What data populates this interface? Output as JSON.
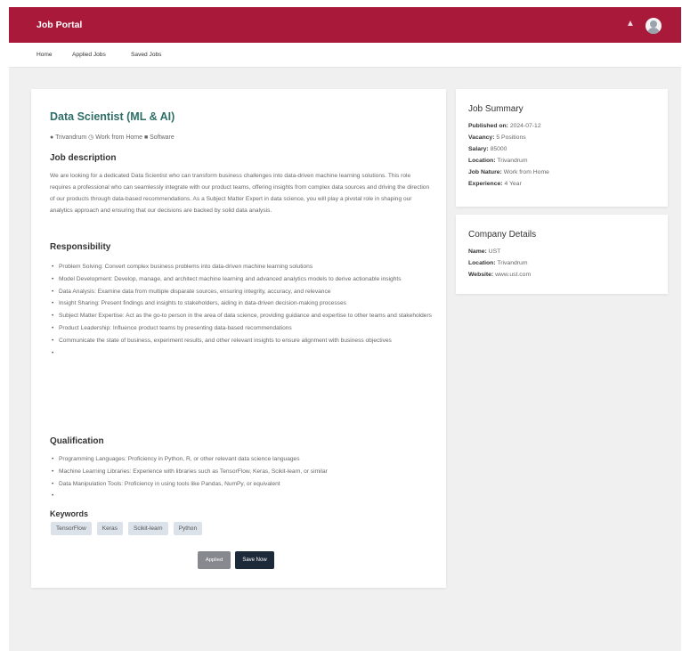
{
  "header": {
    "brand": "Job Portal"
  },
  "nav": {
    "items": [
      "Home",
      "Applied Jobs",
      "Saved Jobs"
    ]
  },
  "job": {
    "title": "Data Scientist (ML & AI)",
    "location": "Trivandrum",
    "work_mode": "Work from Home",
    "category": "Software",
    "description_heading": "Job description",
    "description": "We are looking for a dedicated Data Scientist who can transform business challenges into data-driven machine learning solutions. This role requires a professional who can seamlessly integrate with our product teams, offering insights from complex data sources and driving the direction of our products through data-based recommendations. As a Subject Matter Expert in data science, you will play a pivotal role in shaping our analytics approach and ensuring that our decisions are backed by solid data analysis.",
    "responsibility_heading": "Responsibility",
    "responsibilities": [
      "Problem Solving: Convert complex business problems into data-driven machine learning solutions",
      "Model Development: Develop, manage, and architect machine learning and advanced analytics models to derive actionable insights",
      "Data Analysis: Examine data from multiple disparate sources, ensuring integrity, accuracy, and relevance",
      "Insight Sharing: Present findings and insights to stakeholders, aiding in data-driven decision-making processes",
      "Subject Matter Expertise: Act as the go-to person in the area of data science, providing guidance and expertise to other teams and stakeholders",
      "Product Leadership: Influence product teams by presenting data-based recommendations",
      "Communicate the state of business, experiment results, and other relevant insights to ensure alignment with business objectives",
      ""
    ],
    "qualification_heading": "Qualification",
    "qualifications": [
      "Programming Languages: Proficiency in Python, R, or other relevant data science languages",
      "Machine Learning Libraries: Experience with libraries such as TensorFlow, Keras, Scikit-learn, or similar",
      "Data Manipulation Tools: Proficiency in using tools like Pandas, NumPy, or equivalent",
      ""
    ],
    "keywords_heading": "Keywords",
    "keywords": [
      "TensorFlow",
      "Keras",
      "Scikit-learn",
      "Python"
    ],
    "applied_label": "Applied",
    "save_label": "Save Now"
  },
  "summary": {
    "title": "Job Summary",
    "published_label": "Published on:",
    "published_value": "2024-07-12",
    "vacancy_label": "Vacancy:",
    "vacancy_value": "5 Positions",
    "salary_label": "Salary:",
    "salary_value": "85000",
    "location_label": "Location:",
    "location_value": "Trivandrum",
    "nature_label": "Job Nature:",
    "nature_value": "Work from Home",
    "experience_label": "Experience:",
    "experience_value": "4 Year"
  },
  "company": {
    "title": "Company Details",
    "name_label": "Name:",
    "name_value": "UST",
    "location_label": "Location:",
    "location_value": "Trivandrum",
    "website_label": "Website:",
    "website_value": "www.ust.com"
  },
  "icons": {
    "bell": "bell-icon",
    "avatar": "user-avatar",
    "location": "map-pin-icon",
    "category": "briefcase-icon"
  },
  "colors": {
    "header": "#a8193a",
    "title": "#2f6e68",
    "save_button": "#1d2a3a",
    "applied_button": "#868a8f",
    "tag_bg": "#dbe2ea"
  }
}
